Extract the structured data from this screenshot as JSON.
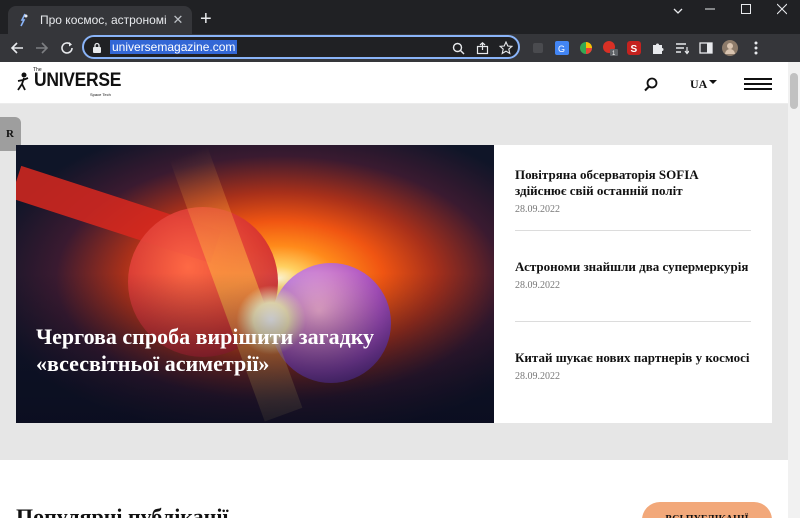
{
  "browser": {
    "tab_title": "Про космос, астрономію та кос",
    "tab_close": "✕",
    "new_tab": "+",
    "url": "universemagazine.com",
    "window_controls": {
      "minimize": "—",
      "maximize": "☐",
      "close": "✕",
      "tab_search": "⌄"
    }
  },
  "site": {
    "logo": {
      "word": "UNIVERSE",
      "the": "The",
      "sub": "Space Tech"
    },
    "language": "UA",
    "side_tab": "R"
  },
  "slider": {
    "title": "Чергова спроба вирішити загадку «всесвітньої асиметрії»",
    "dot_count": 5,
    "active_dot": 2
  },
  "news": [
    {
      "title": "Повітряна обсерваторія SOFIA здійснює свій останній політ",
      "date": "28.09.2022"
    },
    {
      "title": "Астрономи знайшли два супермеркурія",
      "date": "28.09.2022"
    },
    {
      "title": "Китай шукає нових партнерів у космосі",
      "date": "28.09.2022"
    }
  ],
  "lower": {
    "section_title": "Популярні публікації",
    "all_button": "ВСІ ПУБЛІКАЦІЇ"
  },
  "colors": {
    "accent": "#f2a87a",
    "omnibox_border": "#8ab4f8",
    "url_highlight": "#3367d6"
  }
}
